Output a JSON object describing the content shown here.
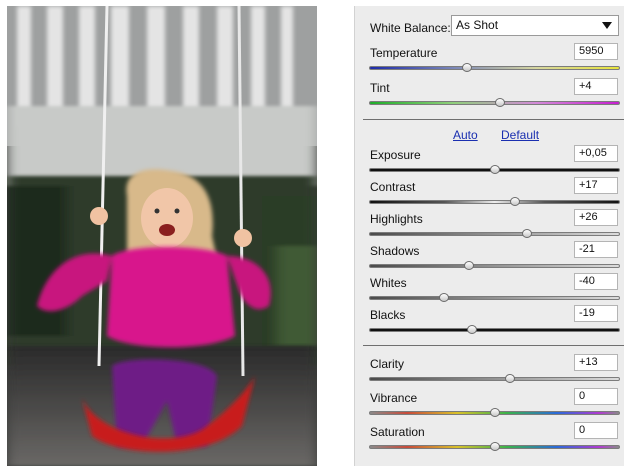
{
  "panel": {
    "white_balance": {
      "label": "White Balance:",
      "selected": "As Shot"
    },
    "links": {
      "auto": "Auto",
      "default": "Default"
    },
    "sliders": [
      {
        "id": "temperature",
        "label": "Temperature",
        "value": "5950",
        "position": 0.39,
        "track": "temperature"
      },
      {
        "id": "tint",
        "label": "Tint",
        "value": "+4",
        "position": 0.52,
        "track": "tint"
      },
      {
        "id": "exposure",
        "label": "Exposure",
        "value": "+0,05",
        "position": 0.5,
        "track": "dark"
      },
      {
        "id": "contrast",
        "label": "Contrast",
        "value": "+17",
        "position": 0.58,
        "track": "contrast"
      },
      {
        "id": "highlights",
        "label": "Highlights",
        "value": "+26",
        "position": 0.63,
        "track": "gray"
      },
      {
        "id": "shadows",
        "label": "Shadows",
        "value": "-21",
        "position": 0.4,
        "track": "gray"
      },
      {
        "id": "whites",
        "label": "Whites",
        "value": "-40",
        "position": 0.3,
        "track": "gray"
      },
      {
        "id": "blacks",
        "label": "Blacks",
        "value": "-19",
        "position": 0.41,
        "track": "dark"
      },
      {
        "id": "clarity",
        "label": "Clarity",
        "value": "+13",
        "position": 0.56,
        "track": "gray"
      },
      {
        "id": "vibrance",
        "label": "Vibrance",
        "value": "0",
        "position": 0.5,
        "track": "spectrum"
      },
      {
        "id": "saturation",
        "label": "Saturation",
        "value": "0",
        "position": 0.5,
        "track": "spectrum"
      }
    ]
  }
}
